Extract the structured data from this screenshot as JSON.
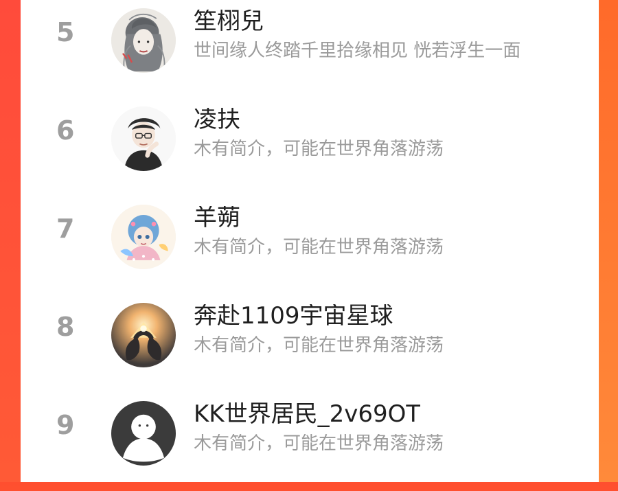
{
  "ranking": {
    "items": [
      {
        "rank": "5",
        "name": "笙栩兒",
        "bio": "世间缘人终踏千里拾缘相见 恍若浮生一面",
        "avatar_icon": "female-ink-portrait-avatar-icon"
      },
      {
        "rank": "6",
        "name": "凌扶",
        "bio": "木有简介，可能在世界角落游荡",
        "avatar_icon": "boy-with-glasses-avatar-icon"
      },
      {
        "rank": "7",
        "name": "羊蒴",
        "bio": "木有简介，可能在世界角落游荡",
        "avatar_icon": "anime-girl-avatar-icon"
      },
      {
        "rank": "8",
        "name": "奔赴1109宇宙星球",
        "bio": "木有简介，可能在世界角落游荡",
        "avatar_icon": "heart-hands-light-avatar-icon"
      },
      {
        "rank": "9",
        "name": "KK世界居民_2v69OT",
        "bio": "木有简介，可能在世界角落游荡",
        "avatar_icon": "default-user-avatar-icon"
      }
    ]
  }
}
